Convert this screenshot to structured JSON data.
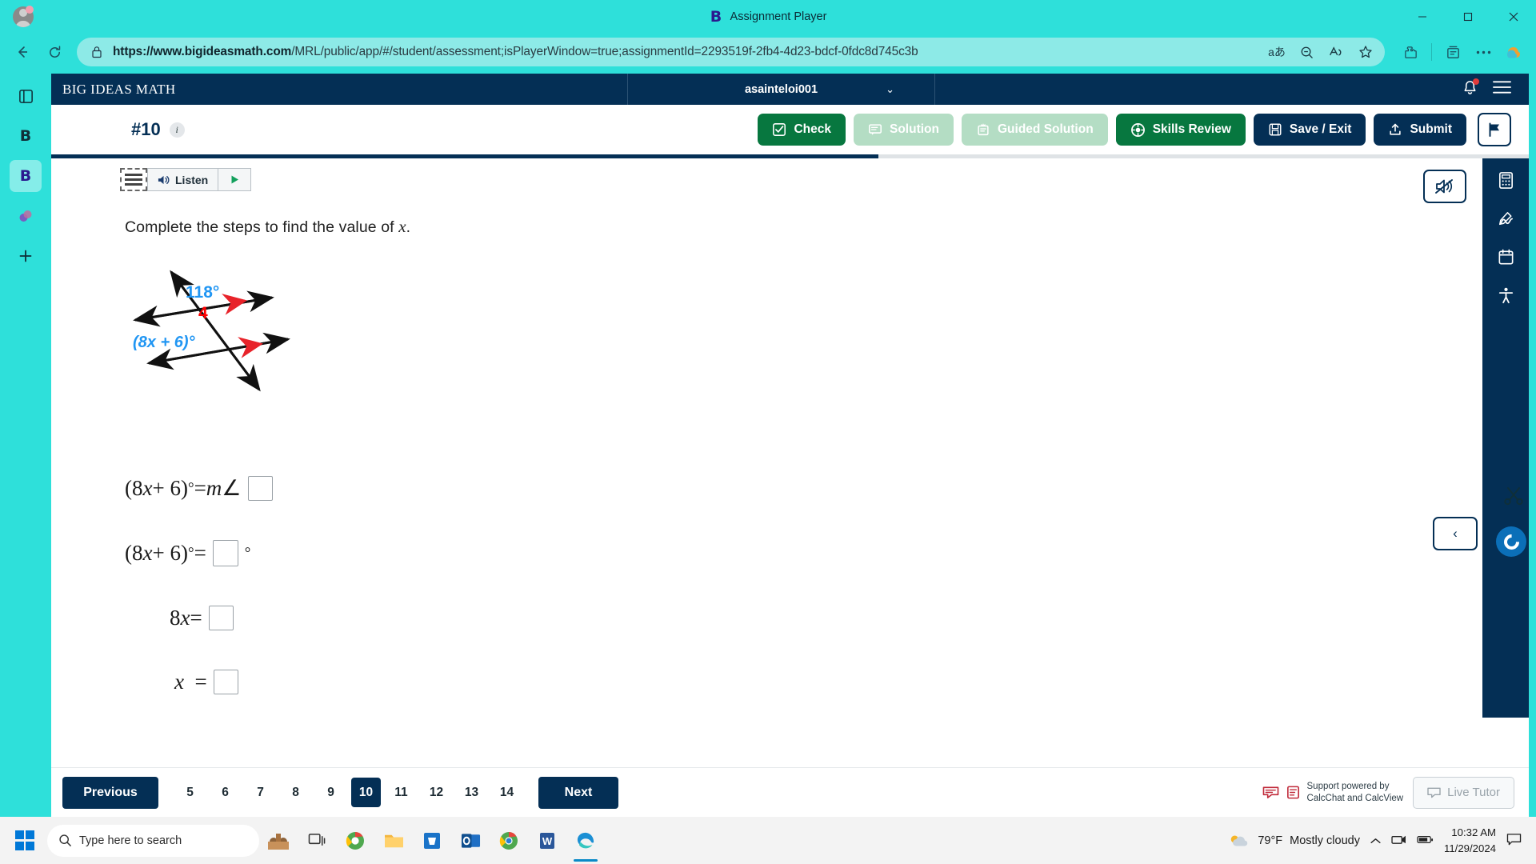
{
  "browser": {
    "window_title": "Assignment Player",
    "url_full": "https://www.bigideasmath.com/MRL/public/app/#/student/assessment;isPlayerWindow=true;assignmentId=2293519f-2fb4-4d23-bdcf-0fdc8d745c3b",
    "url_domain": "https://www.bigideasmath.com",
    "url_path": "/MRL/public/app/#/student/assessment;isPlayerWindow=true;assignmentId=2293519f-2fb4-4d23-bdcf-0fdc8d745c3b",
    "theme_color": "#2ee0da",
    "nav": {
      "back": "back-arrow",
      "refresh": "refresh",
      "translate": "translate",
      "zoom_out": "zoom-out",
      "read_aloud": "read-aloud",
      "favorite": "favorite-star",
      "extensions": "extensions",
      "collections": "collections",
      "more": "more-options",
      "copilot": "copilot"
    },
    "window_buttons": {
      "minimize": "minimize",
      "maximize": "maximize",
      "close": "close"
    }
  },
  "app": {
    "brand": "BIG IDEAS MATH",
    "username": "asainteloi001",
    "question_number": "#10",
    "progress_percent": 56,
    "toolbar": {
      "check": "Check",
      "solution": "Solution",
      "guided_solution": "Guided Solution",
      "skills_review": "Skills Review",
      "save_exit": "Save / Exit",
      "submit": "Submit",
      "flag": "flag-icon"
    },
    "accessibility": {
      "listen": "Listen",
      "play": "play-icon",
      "mute": "mute-icon"
    },
    "question": {
      "prompt_before": "Complete the steps to find the value of",
      "prompt_var": "x",
      "prompt_after": "."
    },
    "diagram": {
      "angle_label": "118°",
      "angle_number": "4",
      "expression_label": "(8x + 6)°",
      "angle_color": "#2196f3",
      "number_color": "#ff0000",
      "arrow_mark_color": "#e8232a"
    },
    "steps": [
      {
        "lhs": "(8x + 6)° = m∠",
        "box": "",
        "suffix": ""
      },
      {
        "lhs": "(8x + 6)° =",
        "box": "",
        "suffix": "°"
      },
      {
        "lhs": "8x =",
        "box": "",
        "suffix": ""
      },
      {
        "lhs": "x  =",
        "box": "",
        "suffix": ""
      }
    ],
    "bottom": {
      "previous": "Previous",
      "next": "Next",
      "pages": [
        "5",
        "6",
        "7",
        "8",
        "9",
        "10",
        "11",
        "12",
        "13",
        "14"
      ],
      "active_page": "10",
      "support_line1": "Support powered by",
      "support_line2": "CalcChat and CalcView",
      "live_tutor": "Live Tutor"
    },
    "tool_rail": [
      "calculator-icon",
      "draw-icon",
      "notes-icon",
      "accessibility-icon"
    ],
    "collapse": "collapse-panel-icon"
  },
  "taskbar": {
    "search_placeholder": "Type here to search",
    "temperature": "79°F",
    "weather_text": "Mostly cloudy",
    "time": "10:32 AM",
    "date": "11/29/2024",
    "apps": [
      "start",
      "search",
      "task-view",
      "chrome-alt",
      "file-explorer",
      "store",
      "outlook",
      "chrome",
      "word",
      "edge"
    ]
  }
}
